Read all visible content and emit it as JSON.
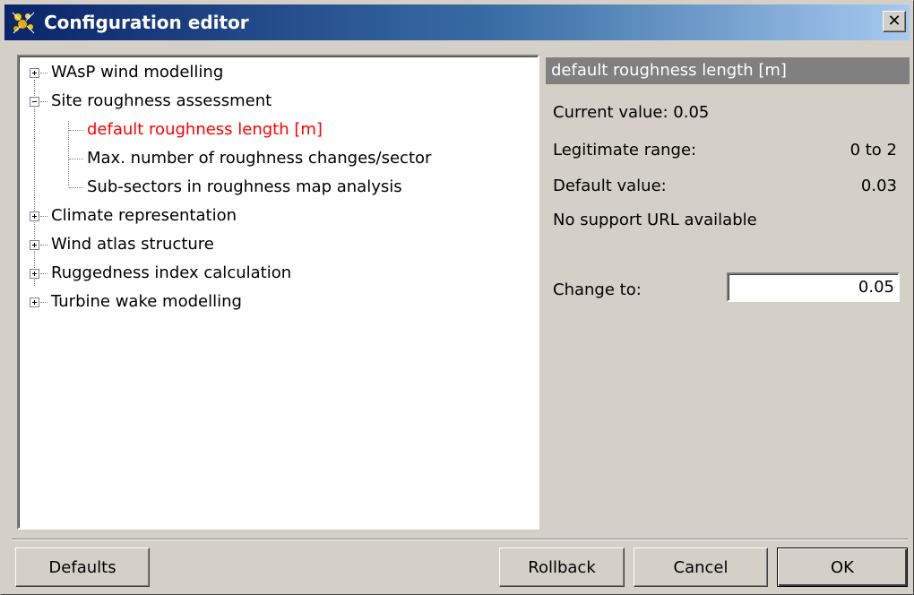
{
  "window": {
    "title": "Configuration editor",
    "close_glyph": "✕",
    "icon": "sparkle-app-icon"
  },
  "tree": {
    "items": [
      {
        "label": "WAsP wind modelling",
        "level": 0,
        "expander": "plus"
      },
      {
        "label": "Site roughness assessment",
        "level": 0,
        "expander": "minus"
      },
      {
        "label": "default roughness length [m]",
        "level": 1,
        "selected": true
      },
      {
        "label": "Max. number of roughness changes/sector",
        "level": 1
      },
      {
        "label": "Sub-sectors in roughness map analysis",
        "level": 1
      },
      {
        "label": "Climate representation",
        "level": 0,
        "expander": "plus"
      },
      {
        "label": "Wind atlas structure",
        "level": 0,
        "expander": "plus"
      },
      {
        "label": "Ruggedness index calculation",
        "level": 0,
        "expander": "plus"
      },
      {
        "label": "Turbine wake modelling",
        "level": 0,
        "expander": "plus"
      }
    ]
  },
  "properties": {
    "header": "default roughness length [m]",
    "current_value": "Current value: 0.05",
    "range_label": "Legitimate range:",
    "range_value": "0 to 2",
    "default_label": "Default value:",
    "default_value": "0.03",
    "support_url": "No support URL available",
    "change_label": "Change to:",
    "change_value": "0.05"
  },
  "buttons": {
    "defaults": "Defaults",
    "rollback": "Rollback",
    "cancel": "Cancel",
    "ok": "OK"
  },
  "colors": {
    "selected_text": "#ff0000",
    "header_bg": "#808080",
    "title_gradient_start": "#0a246a"
  }
}
